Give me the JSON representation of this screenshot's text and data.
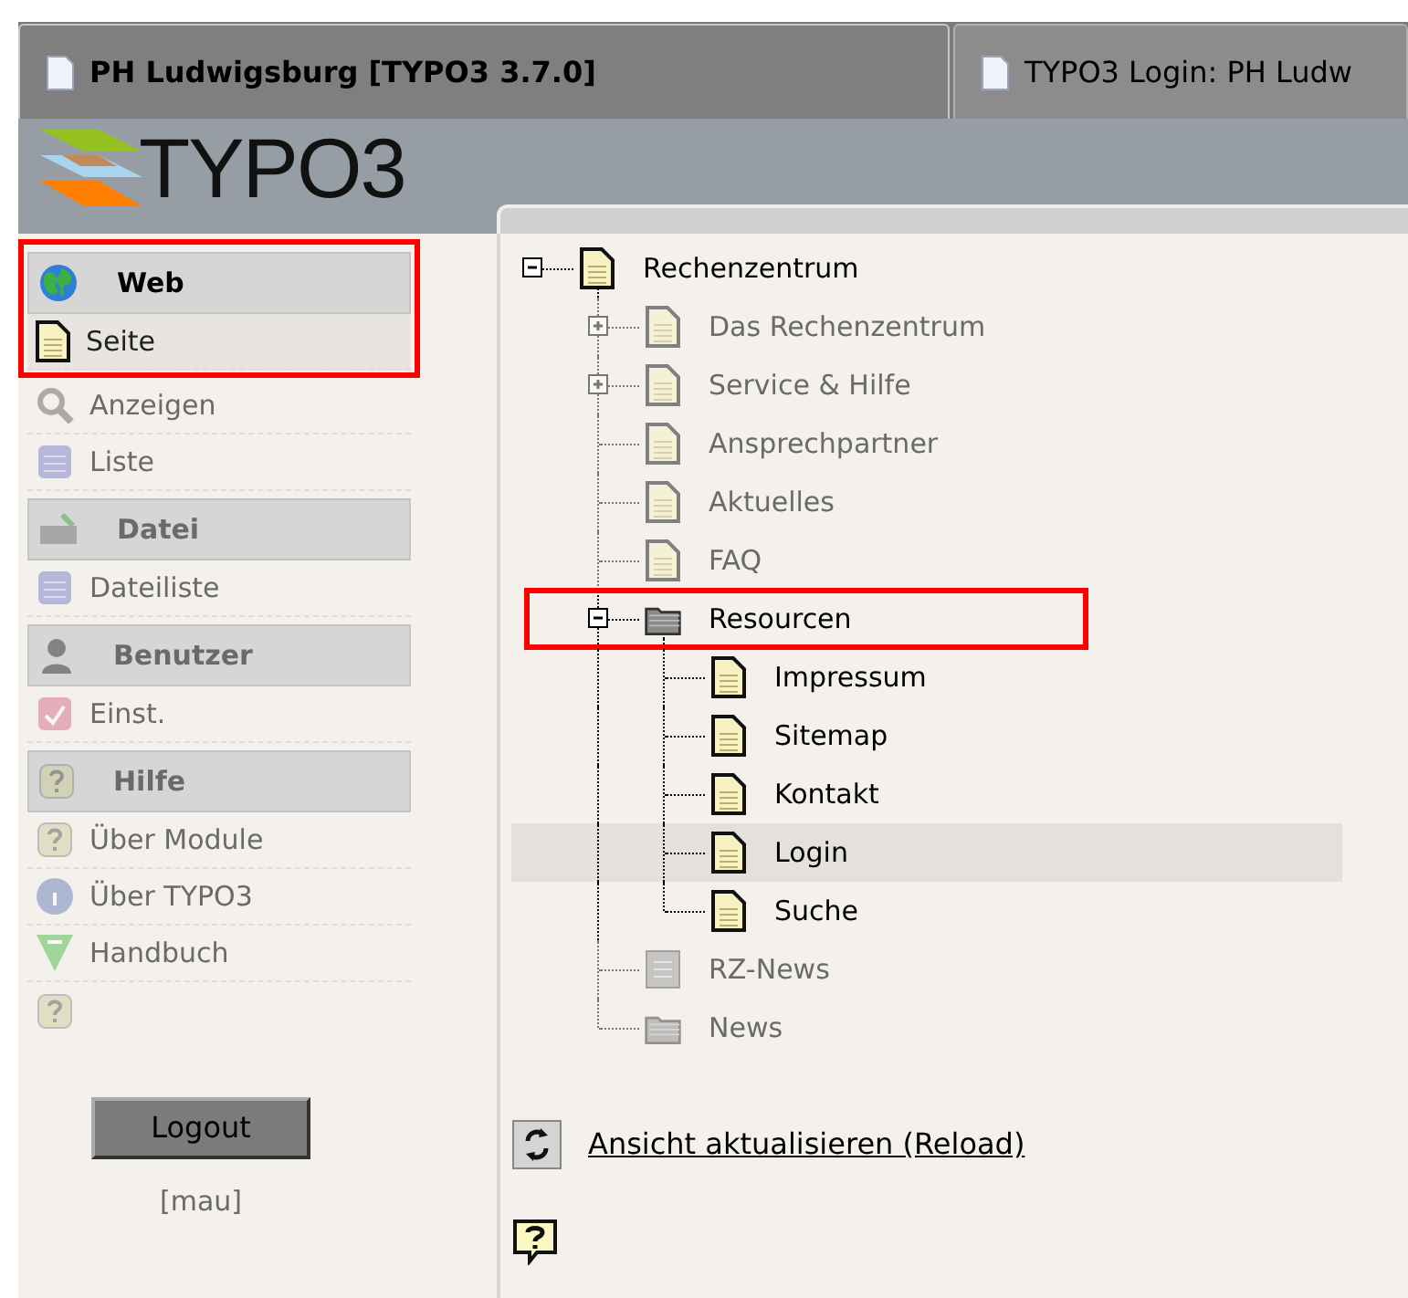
{
  "tabs": [
    {
      "label": "PH Ludwigsburg [TYPO3 3.7.0]",
      "selected": true
    },
    {
      "label": "TYPO3 Login: PH Ludw",
      "selected": false
    }
  ],
  "logo": {
    "text": "TYPO3"
  },
  "modules": [
    {
      "kind": "group",
      "label": "Web",
      "blurred": false,
      "marked": true
    },
    {
      "kind": "module",
      "label": "Seite",
      "blurred": false,
      "marked": true
    },
    {
      "kind": "module",
      "label": "Anzeigen",
      "blurred": true,
      "marked": false
    },
    {
      "kind": "module",
      "label": "Liste",
      "blurred": true,
      "marked": false
    },
    {
      "kind": "group",
      "label": "Datei",
      "blurred": true,
      "marked": false
    },
    {
      "kind": "module",
      "label": "Dateiliste",
      "blurred": true,
      "marked": false
    },
    {
      "kind": "group",
      "label": "Benutzer",
      "blurred": true,
      "marked": false
    },
    {
      "kind": "module",
      "label": "Einst.",
      "blurred": true,
      "marked": false
    },
    {
      "kind": "group",
      "label": "Hilfe",
      "blurred": true,
      "marked": false
    },
    {
      "kind": "module",
      "label": "Über Module",
      "blurred": true,
      "marked": false
    },
    {
      "kind": "module",
      "label": "Über TYPO3",
      "blurred": true,
      "marked": false
    },
    {
      "kind": "module",
      "label": "Handbuch",
      "blurred": true,
      "marked": false
    },
    {
      "kind": "icon",
      "blurred": true,
      "marked": false
    }
  ],
  "logout": {
    "label": "Logout",
    "user": "[mau]"
  },
  "tree": [
    {
      "kind": "page",
      "label": "Rechenzentrum",
      "expanded": true,
      "blurred": false,
      "selected": false,
      "marked": false,
      "children": [
        {
          "kind": "page",
          "label": "Das Rechenzentrum",
          "expanded": false,
          "blurred": true,
          "selected": false,
          "marked": false
        },
        {
          "kind": "page",
          "label": "Service & Hilfe",
          "expanded": false,
          "blurred": true,
          "selected": false,
          "marked": false
        },
        {
          "kind": "page",
          "label": "Ansprechpartner",
          "blurred": true,
          "selected": false,
          "marked": false
        },
        {
          "kind": "page",
          "label": "Aktuelles",
          "blurred": true,
          "selected": false,
          "marked": false
        },
        {
          "kind": "page",
          "label": "FAQ",
          "blurred": true,
          "selected": false,
          "marked": false
        },
        {
          "kind": "folder",
          "label": "Resourcen",
          "expanded": true,
          "blurred": false,
          "selected": false,
          "marked": true,
          "children": [
            {
              "kind": "page",
              "label": "Impressum",
              "blurred": false,
              "selected": false,
              "marked": false
            },
            {
              "kind": "page",
              "label": "Sitemap",
              "blurred": false,
              "selected": false,
              "marked": false
            },
            {
              "kind": "page",
              "label": "Kontakt",
              "blurred": false,
              "selected": false,
              "marked": false
            },
            {
              "kind": "page",
              "label": "Login",
              "blurred": false,
              "selected": true,
              "marked": false
            },
            {
              "kind": "page",
              "label": "Suche",
              "blurred": false,
              "selected": false,
              "marked": false
            }
          ]
        },
        {
          "kind": "news",
          "label": "RZ-News",
          "blurred": true,
          "selected": false,
          "marked": false
        },
        {
          "kind": "folder",
          "label": "News",
          "blurred": true,
          "selected": false,
          "marked": false
        }
      ]
    }
  ],
  "reload": {
    "label": "Ansicht aktualisieren (Reload)"
  }
}
